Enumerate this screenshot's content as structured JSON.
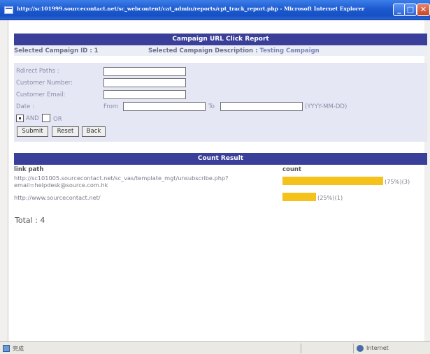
{
  "window": {
    "title": "http://sc101999.sourcecontact.net/sc_webcontent/cat_admin/reports/cpt_track_report.php - Microsoft Internet Explorer",
    "controls": {
      "minimize": "_",
      "maximize": "□",
      "close": "✕"
    }
  },
  "report": {
    "header": "Campaign URL Click Report",
    "campaign_id_label": "Selected Campaign ID : 1",
    "campaign_desc_label": "Selected Campaign Description : ",
    "campaign_desc_value": "Testing Campaign"
  },
  "form": {
    "redirect_paths_label": "Rdirect Paths :",
    "customer_number_label": "Customer Number:",
    "customer_email_label": "Customer Email:",
    "date_label": "Date :",
    "from_label": "From",
    "to_label": "To",
    "date_format_hint": "(YYYY-MM-DD)",
    "and_label": "AND",
    "or_label": "OR",
    "redirect_paths_value": "",
    "customer_number_value": "",
    "customer_email_value": "",
    "date_from_value": "",
    "date_to_value": "",
    "and_checked": true,
    "or_checked": false
  },
  "buttons": {
    "submit": "Submit",
    "reset": "Reset",
    "back": "Back"
  },
  "results": {
    "header": "Count Result",
    "col_link": "link path",
    "col_count": "count",
    "rows": [
      {
        "link_line1": "http://sc101005.sourcecontact.net/sc_vas/template_mgt/unsubscribe.php?",
        "link_line2": "email=helpdesk@source.com.hk",
        "percent": 75,
        "label": "(75%)(3)"
      },
      {
        "link_line1": "http://www.sourcecontact.net/",
        "link_line2": "",
        "percent": 25,
        "label": "(25%)(1)"
      }
    ],
    "total": "Total : 4"
  },
  "statusbar": {
    "status": "完成",
    "zone": "Internet"
  },
  "colors": {
    "section_header": "#3a3f9a",
    "bar": "#f4c21a",
    "form_panel": "#e6e7f4"
  }
}
